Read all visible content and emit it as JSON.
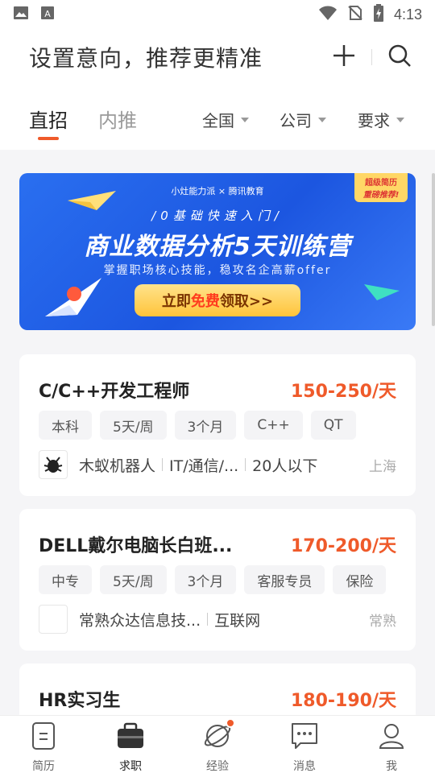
{
  "status_bar": {
    "time": "4:13"
  },
  "header": {
    "title": "设置意向，推荐更精准"
  },
  "tabs": [
    {
      "label": "直招"
    },
    {
      "label": "内推"
    }
  ],
  "filters": [
    {
      "label": "全国"
    },
    {
      "label": "公司"
    },
    {
      "label": "要求"
    }
  ],
  "banner": {
    "brand": "小灶能力派 × 腾讯教育",
    "ribbon_line1": "超级简历",
    "ribbon_line2": "重磅推荐!",
    "sub1": "/0基础快速入门/",
    "headline": "商业数据分析5天训练营",
    "sub2": "掌握职场核心技能，稳攻名企高薪offer",
    "cta_pre": "立即",
    "cta_highlight": "免费",
    "cta_post": "领取>>"
  },
  "jobs": [
    {
      "title": "C/C++开发工程师",
      "salary": "150-250/天",
      "tags": [
        "本科",
        "5天/周",
        "3个月",
        "C++",
        "QT"
      ],
      "company": "木蚁机器人",
      "industry": "IT/通信/...",
      "size": "20人以下",
      "city": "上海"
    },
    {
      "title": "DELL戴尔电脑长白班...",
      "salary": "170-200/天",
      "tags": [
        "中专",
        "5天/周",
        "3个月",
        "客服专员",
        "保险"
      ],
      "company": "常熟众达信息技...",
      "industry": "互联网",
      "city": "常熟"
    },
    {
      "title": "HR实习生",
      "salary": "180-190/天"
    }
  ],
  "bottom_nav": [
    {
      "label": "简历"
    },
    {
      "label": "求职"
    },
    {
      "label": "经验"
    },
    {
      "label": "消息"
    },
    {
      "label": "我"
    }
  ],
  "colors": {
    "accent": "#ef5a2a",
    "banner_blue": "#2a6ff0"
  }
}
